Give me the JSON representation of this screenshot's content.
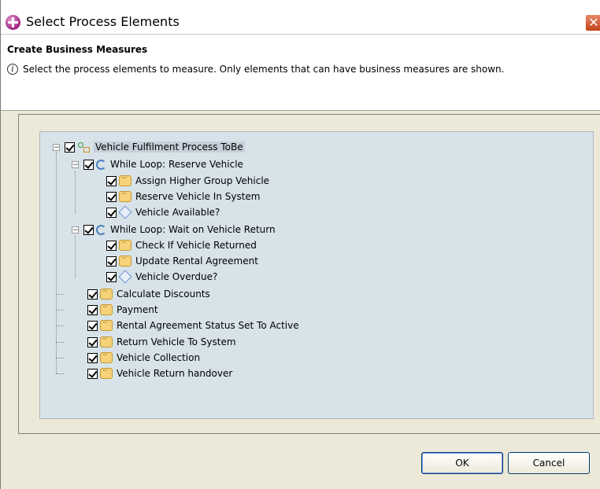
{
  "window": {
    "title": "Select Process Elements",
    "close_glyph": "✕"
  },
  "header": {
    "title": "Create Business Measures",
    "message": "Select the process elements to measure. Only elements that can have business measures are shown."
  },
  "tree": {
    "root": {
      "label": "Vehicle Fulfilment Process ToBe",
      "icon": "process-icon"
    },
    "loop1": {
      "label": "While Loop: Reserve Vehicle",
      "icon": "loop-icon"
    },
    "loop1_children": [
      {
        "label": "Assign Higher Group Vehicle",
        "icon": "task-icon"
      },
      {
        "label": "Reserve Vehicle In System",
        "icon": "task-icon"
      },
      {
        "label": "Vehicle Available?",
        "icon": "decision-icon"
      }
    ],
    "loop2": {
      "label": "While Loop: Wait on Vehicle Return",
      "icon": "loop-icon"
    },
    "loop2_children": [
      {
        "label": "Check If Vehicle Returned",
        "icon": "task-icon"
      },
      {
        "label": "Update Rental Agreement",
        "icon": "task-icon"
      },
      {
        "label": "Vehicle Overdue?",
        "icon": "decision-icon"
      }
    ],
    "root_tasks": [
      {
        "label": "Calculate Discounts",
        "icon": "task-icon"
      },
      {
        "label": "Payment",
        "icon": "task-icon"
      },
      {
        "label": "Rental Agreement Status Set To Active",
        "icon": "task-icon"
      },
      {
        "label": "Return Vehicle To System",
        "icon": "task-icon"
      },
      {
        "label": "Vehicle Collection",
        "icon": "task-icon"
      },
      {
        "label": "Vehicle Return handover",
        "icon": "task-icon"
      }
    ],
    "expander_glyph": "−"
  },
  "buttons": {
    "ok": "OK",
    "cancel": "Cancel"
  }
}
